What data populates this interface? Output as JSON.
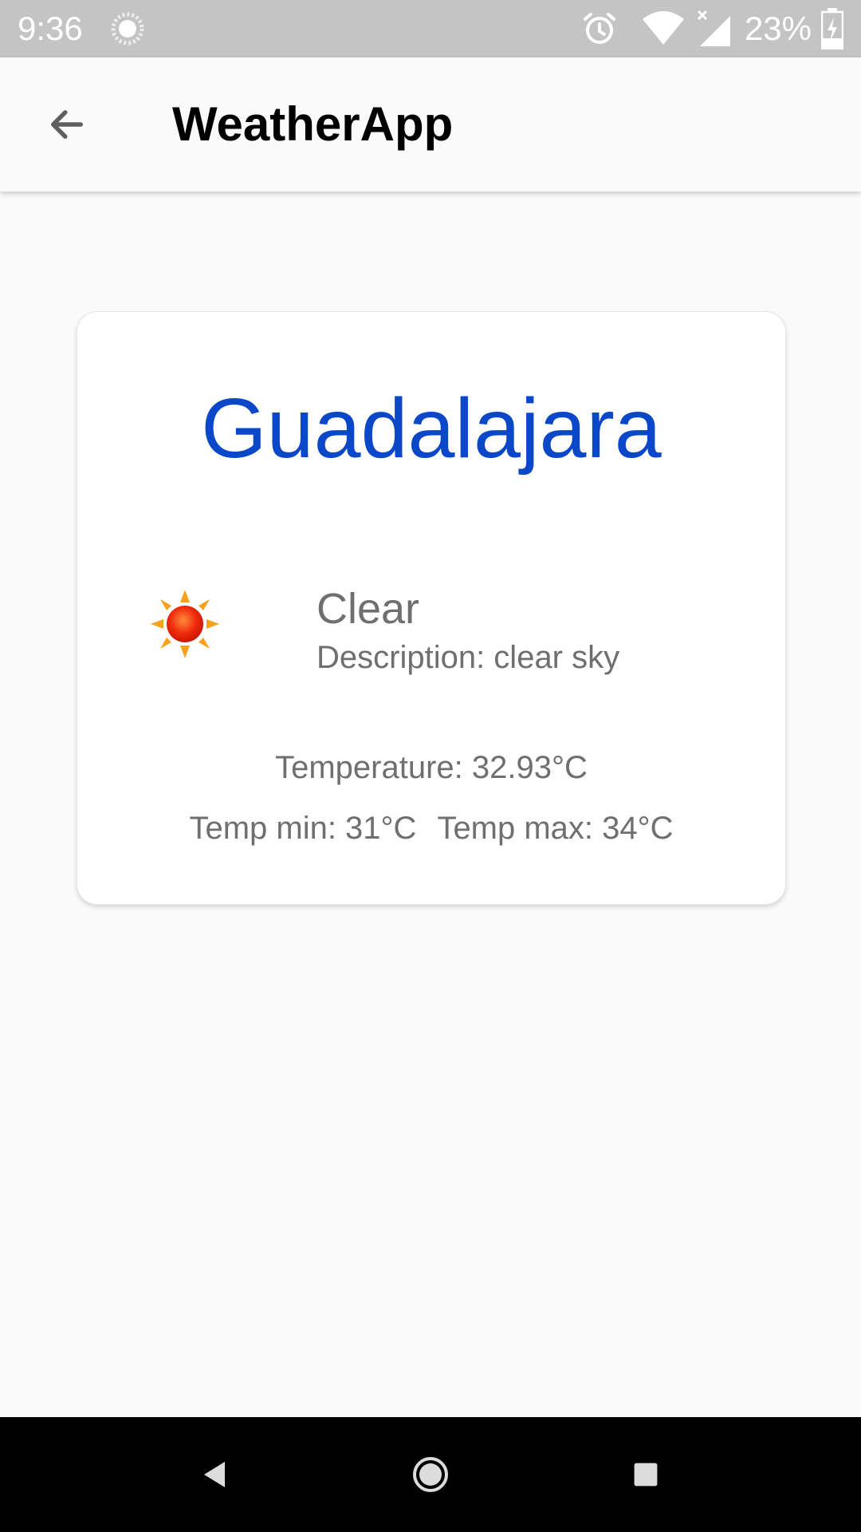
{
  "status_bar": {
    "time": "9:36",
    "battery_percent": "23%",
    "icons": [
      "sync-icon",
      "alarm-icon",
      "wifi-icon",
      "signal-icon",
      "battery-charging-icon"
    ]
  },
  "app_bar": {
    "title": "WeatherApp",
    "back_icon": "arrow-back-icon"
  },
  "weather": {
    "city": "Guadalajara",
    "condition": "Clear",
    "description": "Description: clear sky",
    "temperature": "Temperature: 32.93°C",
    "temp_min": "Temp min: 31°C",
    "temp_max": "Temp max: 34°C",
    "icon": "sun-icon"
  },
  "nav_bar": {
    "icons": [
      "nav-back-icon",
      "nav-home-icon",
      "nav-recents-icon"
    ]
  },
  "colors": {
    "city": "#0a47c9",
    "status_bar": "#c4c4c4",
    "nav_bar": "#000000",
    "secondary_text": "#6f6f6f"
  }
}
